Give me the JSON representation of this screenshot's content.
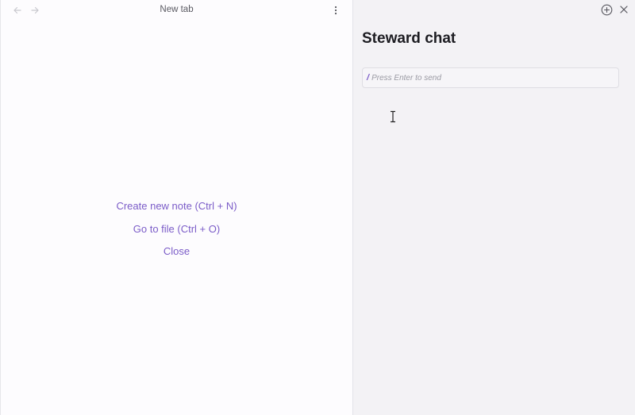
{
  "tab": {
    "title": "New tab"
  },
  "empty_state": {
    "actions": [
      "Create new note (Ctrl + N)",
      "Go to file (Ctrl + O)",
      "Close"
    ]
  },
  "chat": {
    "title": "Steward chat",
    "slash": "/",
    "placeholder": "Press Enter to send",
    "value": ""
  },
  "icons": {
    "back": "arrow-left-icon",
    "forward": "arrow-right-icon",
    "more": "more-vertical-icon",
    "new_chat": "plus-circle-icon",
    "close": "close-icon",
    "cursor": "text-cursor-icon"
  },
  "colors": {
    "accent": "#7b5cc8",
    "left_bg": "#fdfcfe",
    "right_bg": "#f3f2f5"
  }
}
